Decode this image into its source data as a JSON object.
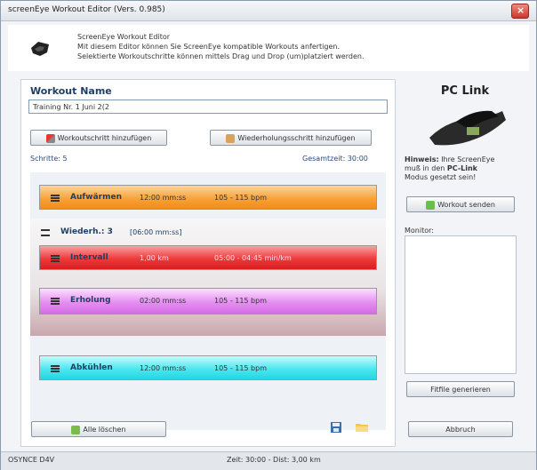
{
  "window": {
    "title": "screenEye Workout Editor (Vers. 0.985)"
  },
  "header": {
    "title": "ScreenEye Workout Editor",
    "line1": "Mit diesem Editor können Sie ScreenEye kompatible Workouts anfertigen.",
    "line2": "Selektierte Workoutschritte können mittels Drag und Drop (um)platziert werden."
  },
  "workout": {
    "name_label": "Workout Name",
    "name_value": "Training Nr. 1 Juni 2(2",
    "add_step_label": "Workoutschritt hinzufügen",
    "add_repeat_label": "Wiederholungsschritt hinzufügen",
    "steps_count": "Schritte: 5",
    "total_time": "Gesamtzeit: 30:00",
    "steps": [
      {
        "name": "Aufwärmen",
        "value": "12:00 mm:ss",
        "target": "105 - 115 bpm",
        "color": "#f7a33a"
      },
      {
        "name": "Intervall",
        "value": "1,00 km",
        "target": "05:00 - 04:45 min/km",
        "color": "#ee3a3a"
      },
      {
        "name": "Erholung",
        "value": "02:00 mm:ss",
        "target": "105 - 115 bpm",
        "color": "#e58ef1"
      },
      {
        "name": "Abkühlen",
        "value": "12:00 mm:ss",
        "target": "105 - 115 bpm",
        "color": "#4de7ef"
      }
    ],
    "repeat": {
      "label": "Wiederh.: 3",
      "time": "[06:00 mm:ss]"
    },
    "delete_all_label": "Alle löschen"
  },
  "pclink": {
    "title": "PC Link",
    "hint_prefix": "Hinweis:",
    "hint_line1": " Ihre ScreenEye",
    "hint_line2_a": "muß in den ",
    "hint_line2_b": "PC-Link",
    "hint_line3": "Modus gesetzt sein!",
    "send_label": "Workout senden",
    "monitor_label": "Monitor:",
    "fitfile_label": "Fitfile generieren",
    "cancel_label": "Abbruch"
  },
  "status": {
    "left": "OSYNCE D4V",
    "center": "Zeit: 30:00 - Dist: 3,00 km"
  },
  "colors": {
    "accent": "#1f3f64",
    "window_bg": "#f2f4f7"
  }
}
